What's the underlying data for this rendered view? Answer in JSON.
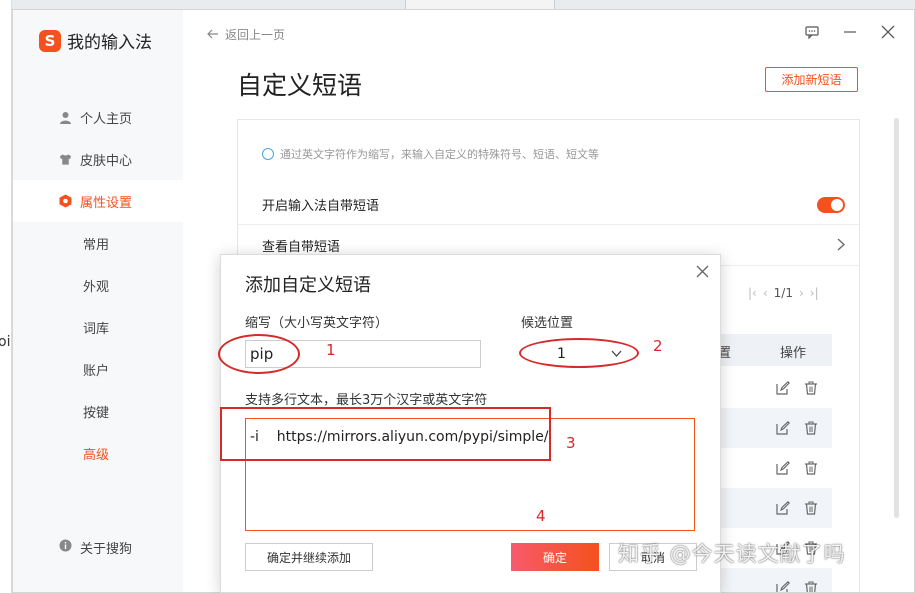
{
  "app": {
    "name": "我的输入法",
    "logo_letter": "S"
  },
  "sidebar": {
    "items": [
      {
        "label": "个人主页",
        "icon": "person-icon"
      },
      {
        "label": "皮肤中心",
        "icon": "shirt-icon"
      },
      {
        "label": "属性设置",
        "icon": "hexagon-icon",
        "active": true
      }
    ],
    "subitems": [
      {
        "label": "常用"
      },
      {
        "label": "外观"
      },
      {
        "label": "词库"
      },
      {
        "label": "账户"
      },
      {
        "label": "按键"
      },
      {
        "label": "高级",
        "active": true
      }
    ],
    "about": "关于搜狗"
  },
  "header": {
    "back": "返回上一页",
    "title": "自定义短语",
    "add_button": "添加新短语"
  },
  "panel": {
    "tip": "通过英文字符作为缩写，来输入自定义的特殊符号、短语、短文等",
    "enable_label": "开启输入法自带短语",
    "enable_on": true,
    "view_label": "查看自带短语",
    "pager": {
      "text": "1/1"
    },
    "table": {
      "col_position_partial": "置",
      "col_actions": "操作",
      "row_count": 6
    }
  },
  "dialog": {
    "title": "添加自定义短语",
    "abbr_label": "缩写（大小写英文字符）",
    "abbr_value": "pip",
    "position_label": "候选位置",
    "position_value": "1",
    "content_label": "支持多行文本，最长3万个汉字或英文字符",
    "content_value": "-i    https://mirrors.aliyun.com/pypi/simple/",
    "continue_button": "确定并继续添加",
    "ok_button": "确定",
    "cancel_button": "取消"
  },
  "annotations": {
    "n1": "1",
    "n2": "2",
    "n3": "3",
    "n4": "4",
    "color": "#d42a2a"
  },
  "background": {
    "fragment": "oi"
  },
  "watermark": "知乎 @今天读文献了吗",
  "colors": {
    "accent": "#f4511e",
    "sidebar_bg": "#f7f8fa"
  }
}
